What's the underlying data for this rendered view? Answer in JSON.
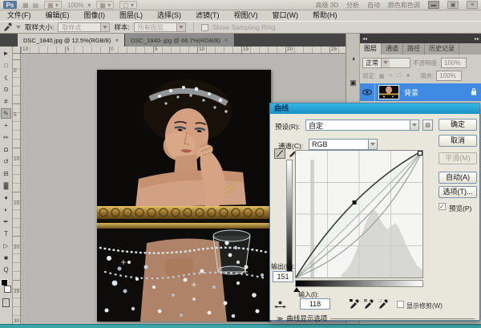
{
  "app_bar": {
    "logo": "Ps",
    "nav_icons": [
      "▦",
      "▤"
    ],
    "view_extras_icon": "▦",
    "zoom_value": "100%",
    "arrange_icon": "▦",
    "screen_mode_icon": "▢",
    "workspace_items": [
      "高级 3D",
      "分析",
      "自动",
      "颜色和色调"
    ],
    "right_buttons": [
      "▬",
      "▣",
      "≡"
    ]
  },
  "menu": {
    "items": [
      "文件(F)",
      "编辑(E)",
      "图像(I)",
      "图层(L)",
      "选择(S)",
      "滤镜(T)",
      "视图(V)",
      "窗口(W)",
      "帮助(H)"
    ]
  },
  "options_bar": {
    "sample_size_label": "取样大小:",
    "sample_size_value": "取样点",
    "sample_label": "样本:",
    "sample_value": "所有图层",
    "sampling_ring_label": "Show Sampling Ring",
    "check_glyph": ""
  },
  "document_tabs": [
    {
      "label": "DSC_1840.jpg @ 12.5%(RGB/8)",
      "close": "×"
    },
    {
      "label": "DSC_1840-.jpg @ 66.7%(RGB/8)",
      "close": "×"
    }
  ],
  "toolbar": {
    "tools": [
      {
        "name": "move",
        "glyph": "►"
      },
      {
        "name": "marquee",
        "glyph": "□"
      },
      {
        "name": "lasso",
        "glyph": "ς"
      },
      {
        "name": "quick-select",
        "glyph": "⊙"
      },
      {
        "name": "crop",
        "glyph": "#"
      },
      {
        "name": "eyedropper",
        "glyph": "✎"
      },
      {
        "name": "healing-brush",
        "glyph": "+"
      },
      {
        "name": "brush",
        "glyph": "✏"
      },
      {
        "name": "clone-stamp",
        "glyph": "◘"
      },
      {
        "name": "history-brush",
        "glyph": "↺"
      },
      {
        "name": "eraser",
        "glyph": "⊟"
      },
      {
        "name": "gradient",
        "glyph": "▓"
      },
      {
        "name": "blur",
        "glyph": "♦"
      },
      {
        "name": "dodge",
        "glyph": "◐"
      },
      {
        "name": "pen",
        "glyph": "✒"
      },
      {
        "name": "type",
        "glyph": "T"
      },
      {
        "name": "path-select",
        "glyph": "▷"
      },
      {
        "name": "shape",
        "glyph": "■"
      },
      {
        "name": "zoom",
        "glyph": "Q"
      }
    ]
  },
  "rulers": {
    "horizontal": [
      "10",
      "5",
      "0",
      "5",
      "10",
      "15",
      "20",
      "25"
    ],
    "vertical": [
      "0",
      "5",
      "10",
      "15",
      "20",
      "25",
      "30"
    ]
  },
  "dock": {
    "collapse_left": "◂◂",
    "collapse_right": "▸▸",
    "strip_icons": [
      {
        "name": "adjustments",
        "glyph": "◑"
      },
      {
        "name": "masks",
        "glyph": "▣"
      }
    ],
    "panel_tabs": [
      "图层",
      "通道",
      "路径",
      "历史记录"
    ],
    "blend_mode": "正常",
    "opacity_label": "不透明度:",
    "opacity_value": "100%",
    "lock_label": "锁定:",
    "lock_icons": [
      "▦",
      "+",
      "□",
      "●"
    ],
    "fill_label": "填充:",
    "fill_value": "100%",
    "layer_name": "背景"
  },
  "curves_dialog": {
    "title": "曲线",
    "preset_label": "预设(R):",
    "preset_value": "自定",
    "preset_menu_icon": "▤",
    "channel_label": "通道(C):",
    "channel_value": "RGB",
    "ok": "确定",
    "cancel": "取消",
    "smooth": "平滑(M)",
    "auto": "自动(A)",
    "options": "选项(T)...",
    "preview_label": "预览(P)",
    "preview_check": "✓",
    "output_label": "输出(O):",
    "output_value": "151",
    "input_label": "输入(I):",
    "input_value": "118",
    "show_clipping_label": "显示修剪(W)",
    "clipping_check": "",
    "display_options_label": "曲线显示选项",
    "display_options_icon": "≫",
    "graph": {
      "curve_point": {
        "input": 118,
        "output": 151
      },
      "aux_curve_mids": [
        [
          56,
          63
        ],
        [
          52,
          56
        ]
      ],
      "histogram": [
        [
          36,
          2
        ],
        [
          40,
          6
        ],
        [
          44,
          12
        ],
        [
          48,
          22
        ],
        [
          52,
          34
        ],
        [
          56,
          45
        ],
        [
          60,
          52
        ],
        [
          63,
          53
        ],
        [
          66,
          47
        ],
        [
          69,
          42
        ],
        [
          72,
          38
        ],
        [
          75,
          40
        ],
        [
          78,
          43
        ],
        [
          81,
          40
        ],
        [
          84,
          33
        ],
        [
          87,
          26
        ],
        [
          90,
          20
        ],
        [
          93,
          14
        ],
        [
          96,
          9
        ],
        [
          100,
          6
        ]
      ],
      "spike": {
        "x": 13,
        "w": 3,
        "h": 93
      },
      "colors": {
        "histogram": "#d7d7d4",
        "spike": "#cfcfcc",
        "curve": "#3a3a3a",
        "aux": "#9aa5a0",
        "diagonal": "#b0b0ad",
        "tint": "#e7f2e8",
        "grid": "#c9c9c6"
      }
    }
  },
  "colors": {
    "selection_blue": "#3f8be4",
    "dialog_title": "#1a92c5",
    "status_teal": "#3ba4a6"
  }
}
